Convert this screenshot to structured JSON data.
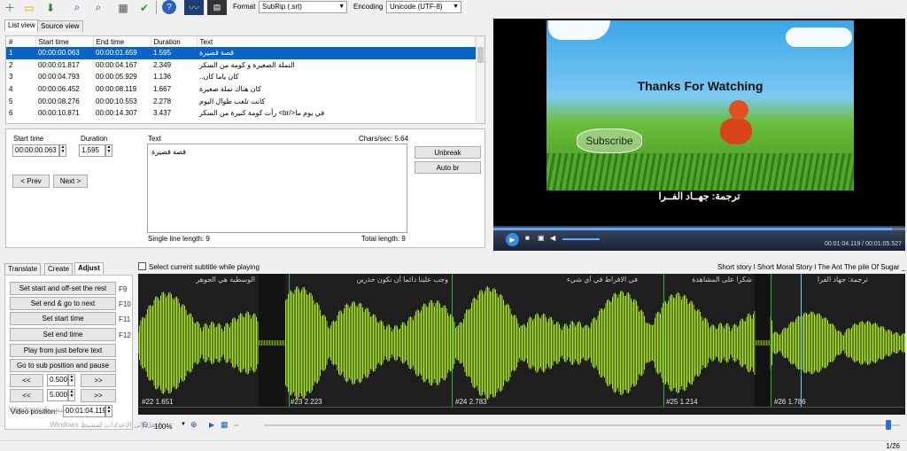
{
  "toolbar": {
    "icons": [
      "new-icon",
      "open-icon",
      "save-icon",
      "find-icon",
      "replace-icon",
      "fix-icon",
      "spellcheck-icon",
      "help-icon",
      "waveform-icon",
      "video-icon"
    ],
    "format_label": "Format",
    "format_value": "SubRip (.srt)",
    "encoding_label": "Encoding",
    "encoding_value": "Unicode (UTF-8)"
  },
  "list_tabs": [
    "List view",
    "Source view"
  ],
  "table": {
    "headers": [
      "#",
      "Start time",
      "End time",
      "Duration",
      "Text"
    ],
    "rows": [
      {
        "n": "1",
        "start": "00:00:00.063",
        "end": "00:00:01.659",
        "dur": "1.595",
        "text": "قصة قصيرة"
      },
      {
        "n": "2",
        "start": "00:00:01.817",
        "end": "00:00:04.167",
        "dur": "2.349",
        "text": "النملة الصغيرة و كومة من السكر"
      },
      {
        "n": "3",
        "start": "00:00:04.793",
        "end": "00:00:05.929",
        "dur": "1.136",
        "text": "..كان ياما كان"
      },
      {
        "n": "4",
        "start": "00:00:06.452",
        "end": "00:00:08.119",
        "dur": "1.667",
        "text": "كان هناك نملة صغيرة"
      },
      {
        "n": "5",
        "start": "00:00:08.276",
        "end": "00:00:10.553",
        "dur": "2.278",
        "text": "كانت تلعب طوال اليوم"
      },
      {
        "n": "6",
        "start": "00:00:10.871",
        "end": "00:00:14.307",
        "dur": "3.437",
        "text": "رأت كومة كبيرة من السكر <br/>في يوم ما"
      }
    ]
  },
  "editor": {
    "start_label": "Start time",
    "start_value": "00:00:00.063",
    "duration_label": "Duration",
    "duration_value": "1.595",
    "prev_label": "< Prev",
    "next_label": "Next >",
    "text_label": "Text",
    "chars_sec": "Chars/sec: 5.64",
    "text_value": "قصة قصيرة",
    "unbreak_label": "Unbreak",
    "autobr_label": "Auto br",
    "single_line": "Single line length: 9",
    "total_length": "Total length: 9"
  },
  "video": {
    "title": "Thanks For Watching",
    "subscribe": "Subscribe",
    "subtitle": "ترجمة: جهــاد الفــرا",
    "time": "00:01:04.119 / 00:01:05.527"
  },
  "adjust": {
    "tabs": [
      "Translate",
      "Create",
      "Adjust"
    ],
    "buttons": [
      {
        "label": "Set start and off-set the rest",
        "key": "F9"
      },
      {
        "label": "Set end & go to next",
        "key": "F10"
      },
      {
        "label": "Set start time",
        "key": "F11"
      },
      {
        "label": "Set end time",
        "key": "F12"
      },
      {
        "label": "Play from just before text",
        "key": ""
      },
      {
        "label": "Go to sub position and pause",
        "key": ""
      }
    ],
    "step1_value": "0.500",
    "step2_value": "5.000",
    "back": "<<",
    "fwd": ">>",
    "video_pos_label": "Video position:",
    "video_pos_value": "00:01:04.119"
  },
  "waveform": {
    "checkbox_label": "Select current subtitle while playing",
    "title_strip": "Short story  l Short Moral Story  l The Ant  The pile Of Sugar _",
    "segments": [
      {
        "label": "#22  1.651",
        "text": "الوسطية هي الجوهر"
      },
      {
        "label": "#23  2.223",
        "text": "وجب علينا دائما أن نكون حذرين"
      },
      {
        "label": "#24  2.783",
        "text": "في الافراط في أي شيء"
      },
      {
        "label": "#25  1.214",
        "text": "شكرا على المشاهدة"
      },
      {
        "label": "#26  1.786",
        "text": "ترجمة: جهاد الفرا"
      }
    ],
    "zoom": "100%",
    "page": "1/26"
  },
  "watermark": [
    "تنشيط Windows",
    "انتقل إلى الإعدادات لتنشيط Windows."
  ]
}
